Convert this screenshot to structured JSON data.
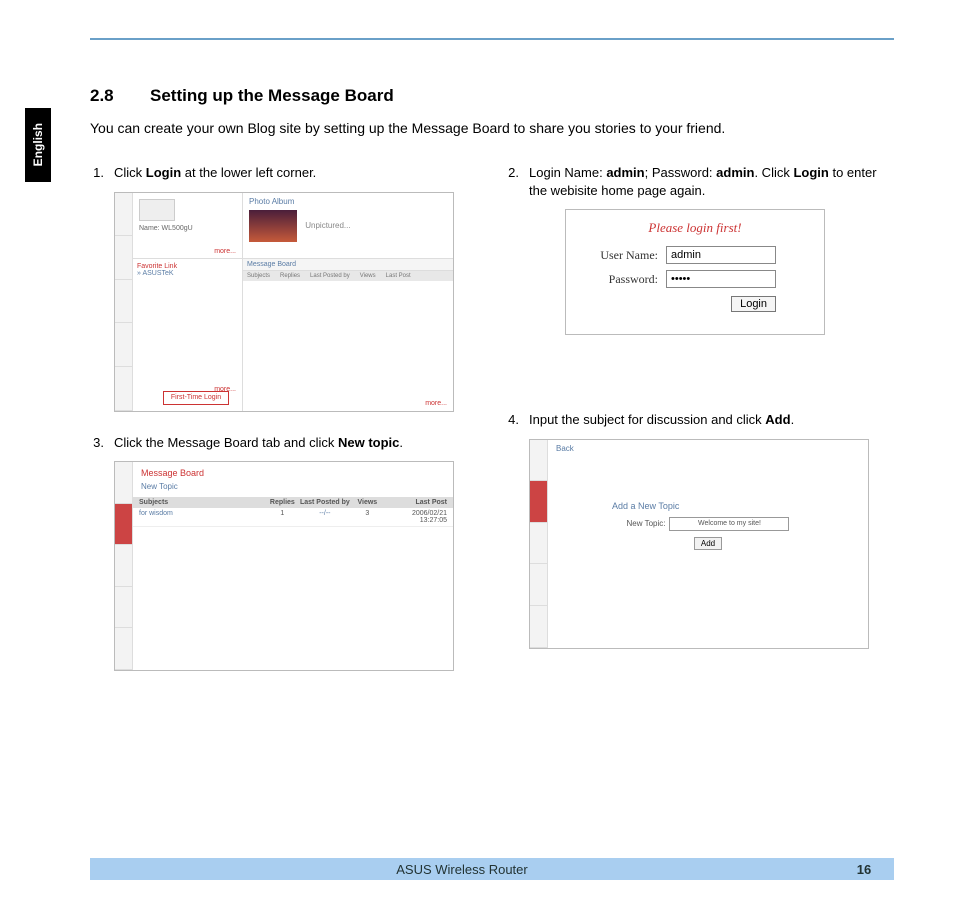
{
  "side_tab": "English",
  "section": {
    "number": "2.8",
    "title": "Setting up the Message Board"
  },
  "intro": "You can create your own Blog site by setting up the Message Board to share you stories to your friend.",
  "steps": {
    "s1": {
      "num": "1.",
      "pre": "Click ",
      "bold": "Login",
      "post": " at the lower left corner."
    },
    "s2": {
      "num": "2.",
      "pre": "Login Name: ",
      "b1": "admin",
      "mid1": "; Password: ",
      "b2": "admin",
      "mid2": ". Click ",
      "b3": "Login",
      "post": " to enter the webisite home page again."
    },
    "s3": {
      "num": "3.",
      "pre": "Click the Message Board tab and click ",
      "bold": "New topic",
      "post": "."
    },
    "s4": {
      "num": "4.",
      "pre": "Input the subject for discussion and click ",
      "bold": "Add",
      "post": "."
    }
  },
  "shot1": {
    "device_name": "Name:   WL500gU",
    "more": "more...",
    "photo_album": "Photo Album",
    "thumb_label": "Unpictured...",
    "fav_header": "Favorite Link",
    "fav_link": "» ASUSTeK",
    "login_btn": "First-Time Login",
    "mb_header": "Message Board",
    "mb_cols": [
      "Subjects",
      "Replies",
      "Last Posted by",
      "Views",
      "Last Post"
    ]
  },
  "shot2": {
    "title": "Please login first!",
    "user_label": "User Name:",
    "user_value": "admin",
    "pass_label": "Password:",
    "pass_value": "•••••",
    "login_btn": "Login"
  },
  "shot3": {
    "title": "Message Board",
    "new_topic": "New Topic",
    "headers": [
      "Subjects",
      "Replies",
      "Last Posted by",
      "Views",
      "Last Post"
    ],
    "row": [
      "for wisdom",
      "1",
      "--/--",
      "3",
      "2006/02/21 13:27:05"
    ]
  },
  "shot4": {
    "back": "Back",
    "add_label": "Add a New Topic",
    "field_label": "New Topic:",
    "field_value": "Welcome to my site!",
    "add_btn": "Add"
  },
  "footer": {
    "title": "ASUS Wireless Router",
    "page": "16"
  }
}
